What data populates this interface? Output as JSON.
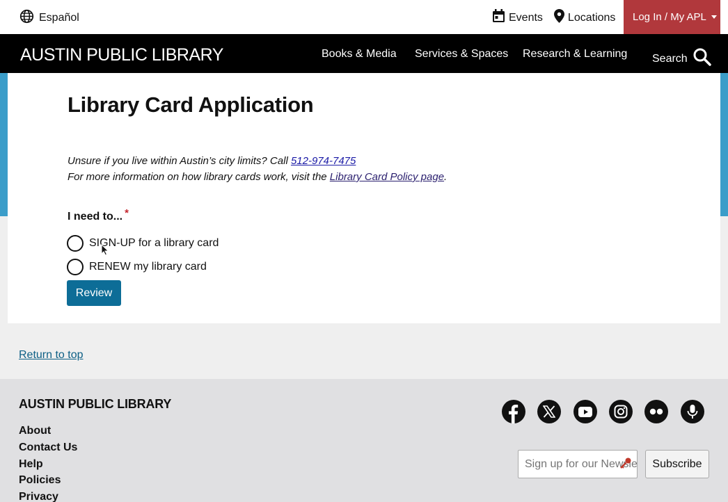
{
  "utility": {
    "language": "Español",
    "events": "Events",
    "locations": "Locations",
    "login": "Log In / My APL"
  },
  "nav": {
    "logo": "AUSTIN PUBLIC LIBRARY",
    "items": [
      "Books & Media",
      "Services & Spaces",
      "Research & Learning"
    ],
    "search": "Search"
  },
  "page": {
    "title": "Library Card Application",
    "intro_line1_prefix": "Unsure if you live within Austin’s city limits? Call ",
    "phone": "512-974-7475",
    "intro_line2_prefix": "For more information on how library cards work, visit the ",
    "policy_link": "Library Card Policy page",
    "intro_line2_suffix": ".",
    "field_label": "I need to...",
    "required_mark": "*",
    "options": [
      "SIGN-UP for a library card",
      "RENEW my library card"
    ],
    "review_button": "Review"
  },
  "return_top": "Return to top",
  "footer": {
    "title": "AUSTIN PUBLIC LIBRARY",
    "links": [
      "About",
      "Contact Us",
      "Help",
      "Policies",
      "Privacy"
    ],
    "social_icons": [
      "facebook-icon",
      "x-icon",
      "youtube-icon",
      "instagram-icon",
      "flickr-icon",
      "podcast-icon"
    ],
    "newsletter_placeholder": "Sign up for our Newsletter",
    "subscribe": "Subscribe"
  },
  "colors": {
    "login_bg": "#b1383c",
    "nav_bg": "#000000",
    "accent_blue": "#3b9dc9",
    "button_blue": "#0d6d97"
  }
}
